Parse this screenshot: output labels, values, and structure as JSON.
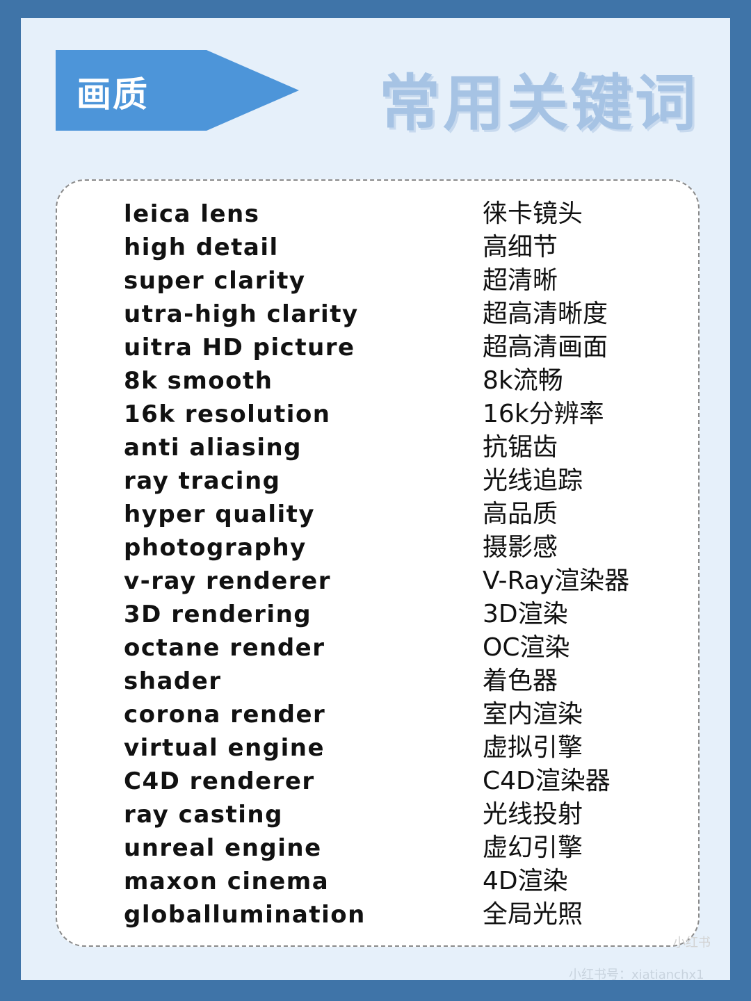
{
  "header": {
    "section_label": "画质",
    "title": "常用关键词"
  },
  "keywords": [
    {
      "en": "leica lens",
      "zh": "徕卡镜头"
    },
    {
      "en": "high detail",
      "zh": "高细节"
    },
    {
      "en": "super clarity",
      "zh": "超清晰"
    },
    {
      "en": "utra-high clarity",
      "zh": "超高清晰度"
    },
    {
      "en": "uitra HD picture",
      "zh": "超高清画面"
    },
    {
      "en": "8k smooth",
      "zh": "8k流畅"
    },
    {
      "en": "16k resolution",
      "zh": "16k分辨率"
    },
    {
      "en": "anti aliasing",
      "zh": "抗锯齿"
    },
    {
      "en": "ray tracing",
      "zh": "光线追踪"
    },
    {
      "en": "hyper quality",
      "zh": "高品质"
    },
    {
      "en": "photography",
      "zh": "摄影感"
    },
    {
      "en": "v-ray renderer",
      "zh": "V-Ray渲染器"
    },
    {
      "en": "3D rendering",
      "zh": "3D渲染"
    },
    {
      "en": "octane render",
      "zh": "OC渲染"
    },
    {
      "en": "shader",
      "zh": "着色器"
    },
    {
      "en": "corona render",
      "zh": "室内渲染"
    },
    {
      "en": "virtual engine",
      "zh": "虚拟引擎"
    },
    {
      "en": "C4D renderer",
      "zh": "C4D渲染器"
    },
    {
      "en": "ray casting",
      "zh": "光线投射"
    },
    {
      "en": "unreal engine",
      "zh": "虚幻引擎"
    },
    {
      "en": "maxon cinema",
      "zh": "4D渲染"
    },
    {
      "en": "globallumination",
      "zh": "全局光照"
    }
  ],
  "watermark": {
    "badge": "小红书",
    "handle": "小红书号：xiatianchx1"
  },
  "colors": {
    "frame": "#3f74a8",
    "panel": "#e6f0fa",
    "banner": "#4d95d9",
    "title": "#a6c3e4"
  }
}
